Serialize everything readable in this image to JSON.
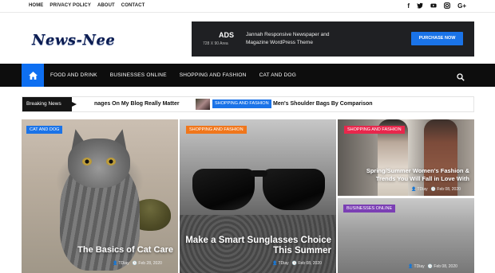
{
  "top_links": [
    "HOME",
    "PRIVACY POLICY",
    "ABOUT",
    "CONTACT"
  ],
  "social_icons": [
    "facebook-icon",
    "twitter-icon",
    "youtube-icon",
    "instagram-icon",
    "google-plus-icon"
  ],
  "logo_text": "News-Nee",
  "ad": {
    "label": "ADS",
    "size": "728 X 90 Area",
    "text": "Jannah Responsive Newspaper and Magazine WordPress Theme",
    "button": "PURCHASE NOW",
    "button_color": "#1a73e8"
  },
  "nav": {
    "items": [
      "FOOD AND DRINK",
      "BUSINESSES ONLINE",
      "SHOPPING AND FASHION",
      "CAT AND DOG"
    ],
    "accent": "#0e6ff1"
  },
  "ticker": {
    "label": "Breaking News",
    "item1": "nages On My Blog Really Matter",
    "badge": "SHOPPING AND FASHION",
    "item2": "Men's Shoulder Bags By Comparison"
  },
  "cards": [
    {
      "category": "CAT AND DOG",
      "category_color": "#1a73e8",
      "title": "The Basics of Cat Care",
      "author": "TDiay",
      "date": "Feb 28, 2020"
    },
    {
      "category": "SHOPPING AND FASHION",
      "category_color": "#f0761b",
      "title": "Make a Smart Sunglasses Choice This Summer",
      "author": "TDiay",
      "date": "Feb 08, 2020"
    },
    {
      "category": "SHOPPING AND FASHION",
      "category_color": "#e8274c",
      "title": "Spring/Summer Women's Fashion & Trends You Will Fall in Love With",
      "author": "TDiay",
      "date": "Feb 08, 2020"
    },
    {
      "category": "BUSINESSES ONLINE",
      "category_color": "#7b3fb4",
      "title": "",
      "author": "TDiay",
      "date": "Feb 08, 2020"
    }
  ]
}
